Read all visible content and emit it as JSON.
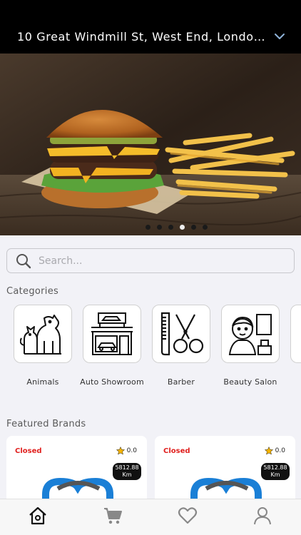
{
  "header": {
    "address": "10 Great Windmill St, West End, London W...",
    "dropdown_icon": "chevron-down-icon"
  },
  "hero": {
    "image": "burger-and-fries-photo",
    "slide_count": 6,
    "active_slide": 4
  },
  "search": {
    "placeholder": "Search...",
    "value": ""
  },
  "categories": {
    "title": "Categories",
    "items": [
      {
        "label": "Animals",
        "icon": "animals-icon"
      },
      {
        "label": "Auto Showroom",
        "icon": "auto-showroom-icon"
      },
      {
        "label": "Barber",
        "icon": "barber-icon"
      },
      {
        "label": "Beauty Salon",
        "icon": "beauty-salon-icon"
      }
    ]
  },
  "featured": {
    "title": "Featured Brands",
    "items": [
      {
        "status": "Closed",
        "rating": "0.0",
        "distance": "5812.88",
        "unit": "Km"
      },
      {
        "status": "Closed",
        "rating": "0.0",
        "distance": "5812.88",
        "unit": "Km"
      }
    ]
  },
  "tabbar": {
    "items": [
      "home-icon",
      "cart-icon",
      "heart-icon",
      "profile-icon"
    ]
  },
  "colors": {
    "header_bg": "#000000",
    "closed_text": "#e0201e",
    "star": "#f5b400",
    "logo_blue": "#1a7fd6"
  }
}
